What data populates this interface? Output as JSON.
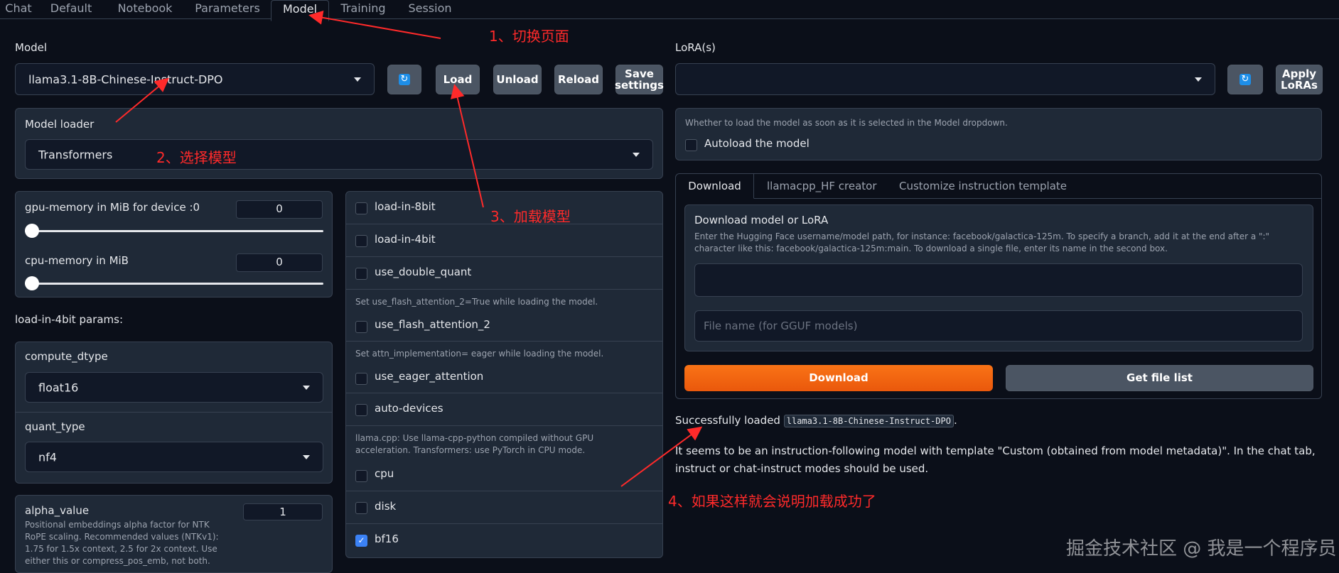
{
  "tabs": [
    "Chat",
    "Default",
    "Notebook",
    "Parameters",
    "Model",
    "Training",
    "Session"
  ],
  "model": {
    "label": "Model",
    "selected": "llama3.1-8B-Chinese-Instruct-DPO",
    "buttons": {
      "load": "Load",
      "unload": "Unload",
      "reload": "Reload",
      "save1": "Save",
      "save2": "settings"
    }
  },
  "loader": {
    "label": "Model loader",
    "selected": "Transformers"
  },
  "gpu": {
    "label": "gpu-memory in MiB for device :0",
    "value": "0"
  },
  "cpu": {
    "label": "cpu-memory in MiB",
    "value": "0"
  },
  "params4bit": {
    "heading": "load-in-4bit params:",
    "compute_label": "compute_dtype",
    "compute_value": "float16",
    "quant_label": "quant_type",
    "quant_value": "nf4"
  },
  "alpha": {
    "label": "alpha_value",
    "value": "1",
    "info1": "Positional embeddings alpha factor for NTK",
    "info2": "RoPE scaling. Recommended values (NTKv1):",
    "info3": "1.75 for 1.5x context, 2.5 for 2x context. Use",
    "info4": "either this or compress_pos_emb, not both."
  },
  "checks": {
    "load8bit": "load-in-8bit",
    "load4bit": "load-in-4bit",
    "double_quant": "use_double_quant",
    "flash_info": "Set use_flash_attention_2=True while loading the model.",
    "flash": "use_flash_attention_2",
    "eager_info": "Set attn_implementation= eager while loading the model.",
    "eager": "use_eager_attention",
    "auto_devices": "auto-devices",
    "cpu_info1": "llama.cpp: Use llama-cpp-python compiled without GPU",
    "cpu_info2": "acceleration. Transformers: use PyTorch in CPU mode.",
    "cpu": "cpu",
    "disk": "disk",
    "bf16": "bf16"
  },
  "lora": {
    "label": "LoRA(s)",
    "apply1": "Apply",
    "apply2": "LoRAs"
  },
  "autoload": {
    "info": "Whether to load the model as soon as it is selected in the Model dropdown.",
    "label": "Autoload the model"
  },
  "subtabs": [
    "Download",
    "llamacpp_HF creator",
    "Customize instruction template"
  ],
  "download": {
    "title": "Download model or LoRA",
    "info1": "Enter the Hugging Face username/model path, for instance: facebook/galactica-125m. To specify a branch, add it at the end after a \":\"",
    "info2": "character like this: facebook/galactica-125m:main. To download a single file, enter its name in the second box.",
    "file_placeholder": "File name (for GGUF models)",
    "download_btn": "Download",
    "list_btn": "Get file list"
  },
  "status": {
    "prefix": "Successfully loaded",
    "model": "llama3.1-8B-Chinese-Instruct-DPO",
    "line2": "It seems to be an instruction-following model with template \"Custom (obtained from model metadata)\". In the chat tab,",
    "line3": "instruct or chat-instruct modes should be used."
  },
  "annotations": {
    "a1": "1、切换页面",
    "a2": "2、选择模型",
    "a3": "3、加载模型",
    "a4": "4、如果这样就会说明加载成功了"
  },
  "watermark": "掘金技术社区 @ 我是一个程序员",
  "colors": {
    "accent": "#f97316",
    "background": "#0b0f19",
    "panel": "#1f2937",
    "annotation": "#ff2a2a"
  }
}
